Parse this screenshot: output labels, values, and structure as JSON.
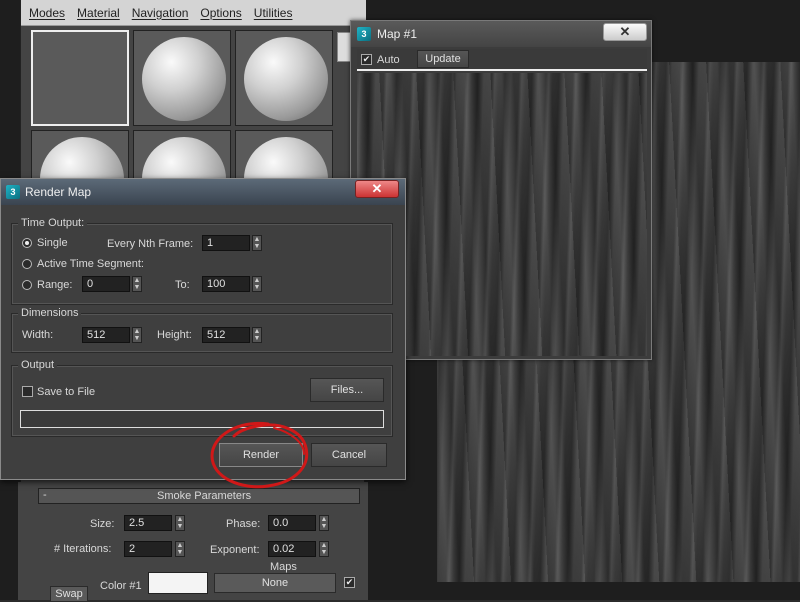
{
  "material_editor": {
    "menu": [
      "Modes",
      "Material",
      "Navigation",
      "Options",
      "Utilities"
    ]
  },
  "smoke_params": {
    "header": "Smoke Parameters",
    "collapse": "-",
    "size_label": "Size:",
    "size_value": "2.5",
    "phase_label": "Phase:",
    "phase_value": "0.0",
    "iterations_label": "# Iterations:",
    "iterations_value": "2",
    "exponent_label": "Exponent:",
    "exponent_value": "0.02",
    "maps_label": "Maps",
    "swap_label": "Swap",
    "color1_label": "Color #1",
    "color1_map": "None",
    "color1_enabled": true
  },
  "map_window": {
    "title": "Map #1",
    "close": "✕",
    "auto_label": "Auto",
    "auto_checked": true,
    "update_label": "Update"
  },
  "render_map": {
    "title": "Render Map",
    "close": "✕",
    "time_output": {
      "title": "Time Output:",
      "single_label": "Single",
      "every_nth_label": "Every Nth Frame:",
      "every_nth_value": "1",
      "active_segment_label": "Active Time Segment:",
      "range_label": "Range:",
      "range_from": "0",
      "to_label": "To:",
      "range_to": "100",
      "selected": "single"
    },
    "dimensions": {
      "title": "Dimensions",
      "width_label": "Width:",
      "width_value": "512",
      "height_label": "Height:",
      "height_value": "512"
    },
    "output": {
      "title": "Output",
      "save_to_file_label": "Save to File",
      "save_to_file_checked": false,
      "files_button": "Files...",
      "path_value": ""
    },
    "render_button": "Render",
    "cancel_button": "Cancel"
  },
  "colors": {
    "highlight_circle": "#d01818",
    "app_logo": "#1fb3c6"
  }
}
